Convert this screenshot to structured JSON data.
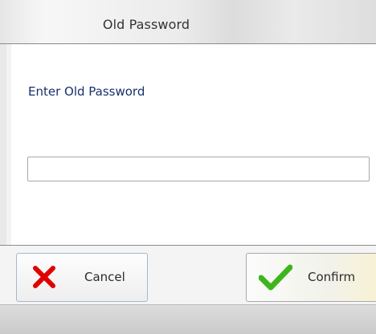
{
  "window": {
    "title": "Old Password"
  },
  "form": {
    "prompt": "Enter Old Password",
    "password_value": ""
  },
  "buttons": {
    "cancel": "Cancel",
    "confirm": "Confirm"
  },
  "icons": {
    "cancel": "cancel-x-icon",
    "confirm": "checkmark-icon"
  },
  "colors": {
    "cancel_icon": "#e00000",
    "confirm_icon": "#3fb51d",
    "prompt_text": "#17306b"
  }
}
